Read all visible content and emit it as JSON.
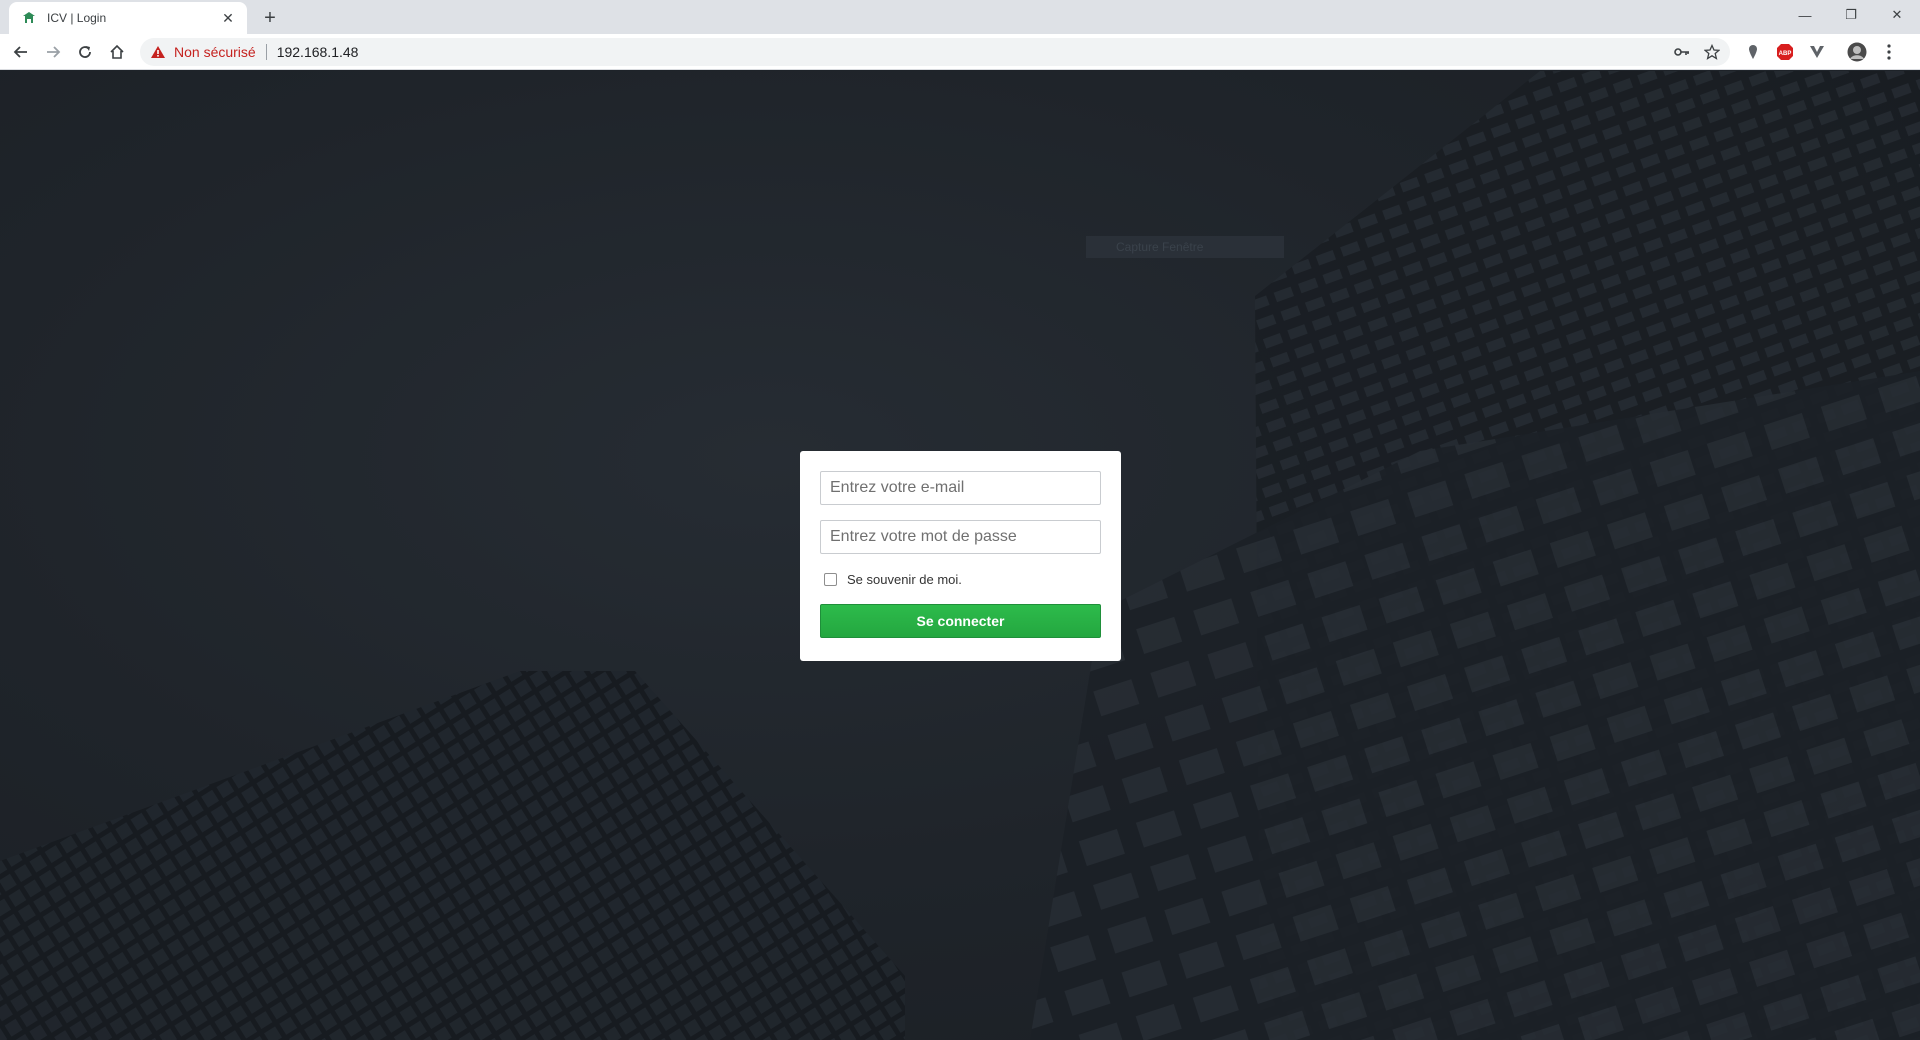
{
  "browser": {
    "tab": {
      "title": "ICV | Login",
      "close": "✕"
    },
    "new_tab": "+",
    "window_controls": {
      "minimize": "—",
      "restore": "❐",
      "close": "✕"
    },
    "security_warning": "Non sécurisé",
    "url": "192.168.1.48",
    "extensions": [
      "location-pin-icon",
      "adblock-icon",
      "vpn-icon",
      "profile-avatar"
    ]
  },
  "page": {
    "ghost_label": "Capture Fenêtre",
    "login": {
      "email_placeholder": "Entrez votre e-mail",
      "email_value": "",
      "password_placeholder": "Entrez votre mot de passe",
      "password_value": "",
      "remember_label": "Se souvenir de moi.",
      "remember_checked": false,
      "submit_label": "Se connecter"
    }
  },
  "colors": {
    "background": "#1e2329",
    "button": "#28b446",
    "warning": "#c5221f"
  }
}
